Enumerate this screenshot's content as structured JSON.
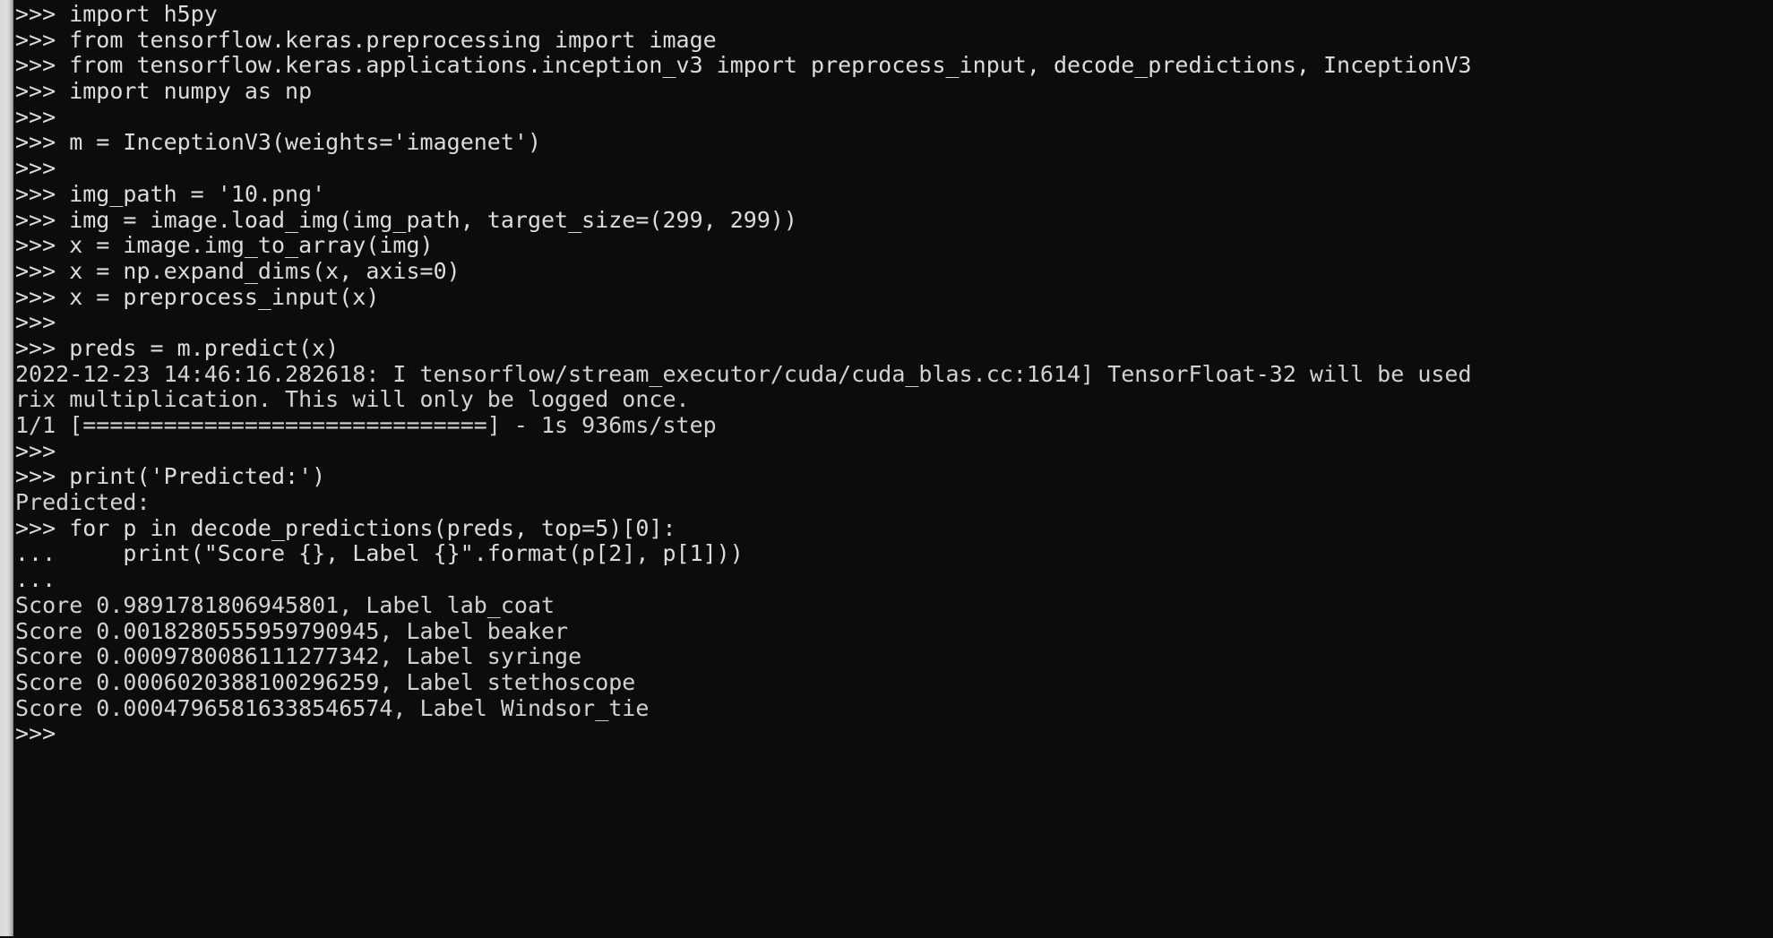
{
  "terminal": {
    "app": "python-interactive-shell",
    "prompt": ">>>",
    "continuation_prompt": "...",
    "colors": {
      "background": "#0c0c0c",
      "foreground": "#d7d7d7",
      "window_border": "#d9d9d9"
    },
    "font_size_px": 25,
    "lines": [
      {
        "kind": "prompt",
        "text": ">>> import h5py"
      },
      {
        "kind": "prompt",
        "text": ">>> from tensorflow.keras.preprocessing import image"
      },
      {
        "kind": "prompt",
        "text": ">>> from tensorflow.keras.applications.inception_v3 import preprocess_input, decode_predictions, InceptionV3"
      },
      {
        "kind": "prompt",
        "text": ">>> import numpy as np"
      },
      {
        "kind": "prompt",
        "text": ">>>"
      },
      {
        "kind": "prompt",
        "text": ">>> m = InceptionV3(weights='imagenet')"
      },
      {
        "kind": "prompt",
        "text": ">>>"
      },
      {
        "kind": "prompt",
        "text": ">>> img_path = '10.png'"
      },
      {
        "kind": "prompt",
        "text": ">>> img = image.load_img(img_path, target_size=(299, 299))"
      },
      {
        "kind": "prompt",
        "text": ">>> x = image.img_to_array(img)"
      },
      {
        "kind": "prompt",
        "text": ">>> x = np.expand_dims(x, axis=0)"
      },
      {
        "kind": "prompt",
        "text": ">>> x = preprocess_input(x)"
      },
      {
        "kind": "prompt",
        "text": ">>>"
      },
      {
        "kind": "prompt",
        "text": ">>> preds = m.predict(x)"
      },
      {
        "kind": "log",
        "text": "2022-12-23 14:46:16.282618: I tensorflow/stream_executor/cuda/cuda_blas.cc:1614] TensorFloat-32 will be used"
      },
      {
        "kind": "log",
        "text": "rix multiplication. This will only be logged once."
      },
      {
        "kind": "output",
        "text": "1/1 [==============================] - 1s 936ms/step"
      },
      {
        "kind": "prompt",
        "text": ">>>"
      },
      {
        "kind": "prompt",
        "text": ">>> print('Predicted:')"
      },
      {
        "kind": "output",
        "text": "Predicted:"
      },
      {
        "kind": "prompt",
        "text": ">>> for p in decode_predictions(preds, top=5)[0]:"
      },
      {
        "kind": "continuation",
        "text": "...     print(\"Score {}, Label {}\".format(p[2], p[1]))"
      },
      {
        "kind": "continuation",
        "text": "..."
      },
      {
        "kind": "output",
        "text": "Score 0.9891781806945801, Label lab_coat"
      },
      {
        "kind": "output",
        "text": "Score 0.0018280555959790945, Label beaker"
      },
      {
        "kind": "output",
        "text": "Score 0.0009780086111277342, Label syringe"
      },
      {
        "kind": "output",
        "text": "Score 0.0006020388100296259, Label stethoscope"
      },
      {
        "kind": "output",
        "text": "Score 0.00047965816338546574, Label Windsor_tie"
      },
      {
        "kind": "prompt",
        "text": ">>>"
      }
    ],
    "predictions": [
      {
        "score": "0.9891781806945801",
        "label": "lab_coat"
      },
      {
        "score": "0.0018280555959790945",
        "label": "beaker"
      },
      {
        "score": "0.0009780086111277342",
        "label": "syringe"
      },
      {
        "score": "0.0006020388100296259",
        "label": "stethoscope"
      },
      {
        "score": "0.00047965816338546574",
        "label": "Windsor_tie"
      }
    ],
    "progress": {
      "steps": "1/1",
      "bar": "[==============================]",
      "elapsed": "1s",
      "per_step": "936ms/step"
    },
    "log": {
      "timestamp": "2022-12-23 14:46:16.282618",
      "level": "I",
      "source": "tensorflow/stream_executor/cuda/cuda_blas.cc:1614",
      "message": "TensorFloat-32 will be used",
      "message_wrapped": "rix multiplication. This will only be logged once."
    }
  }
}
